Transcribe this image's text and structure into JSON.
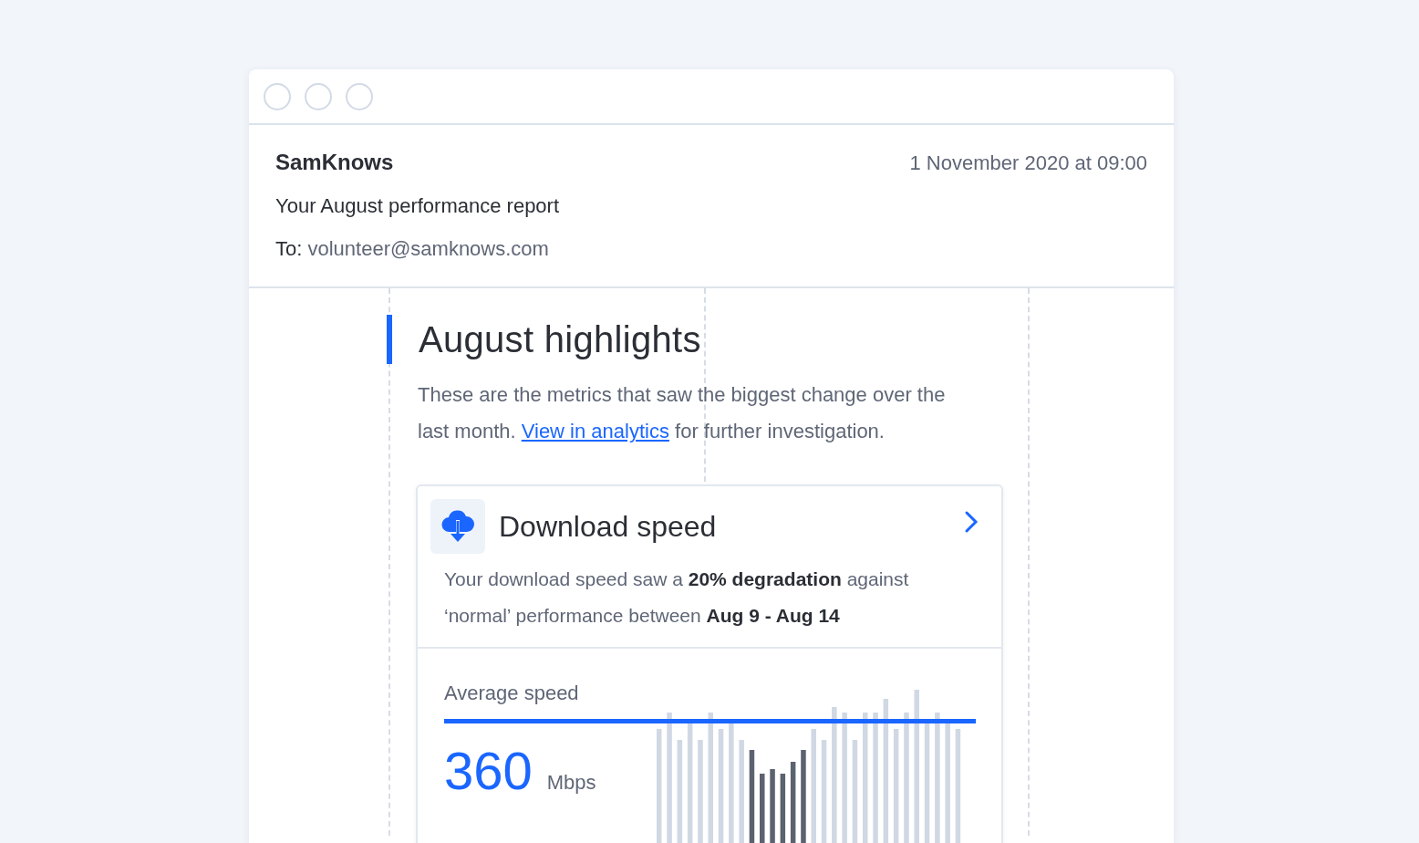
{
  "email": {
    "sender": "SamKnows",
    "date": "1 November 2020 at 09:00",
    "subject": "Your August performance report",
    "to_label": "To:",
    "to_address": "volunteer@samknows.com"
  },
  "highlights": {
    "title": "August highlights",
    "intro_before": "These are the metrics that saw the biggest change over the last month.",
    "link": "View in analytics",
    "intro_after": "for further investigation."
  },
  "card": {
    "title": "Download speed",
    "description": "Your download speed saw a **20% degradation** against ‘normal’ performance between **Aug 9 - Aug 14**",
    "metric": {
      "label": "Average speed",
      "value": "360",
      "unit": "Mbps"
    }
  }
}
